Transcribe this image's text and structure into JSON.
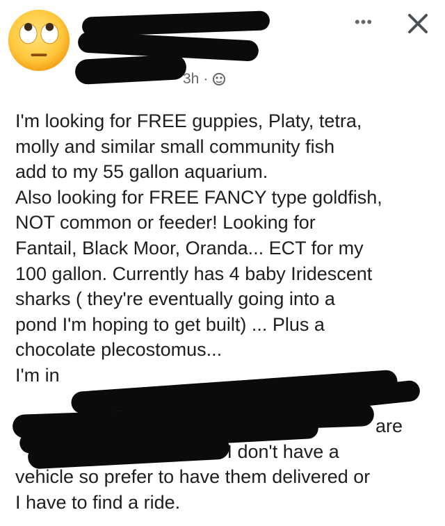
{
  "post": {
    "timestamp": "3h",
    "audience_icon": "globe-icon",
    "more_label": "•••",
    "close_icon": "close-icon",
    "body_lines": [
      "I'm  looking for FREE guppies, Platy, tetra,",
      "molly and similar small community fish",
      "add to my 55 gallon aquarium.",
      "Also looking for FREE FANCY type goldfish,",
      "NOT common or feeder! Looking for",
      "Fantail, Black Moor, Oranda... ECT for my",
      "100 gallon. Currently has 4 baby Iridescent",
      "sharks ( they're eventually going into a",
      "pond I'm hoping to get built) ... Plus a",
      "chocolate plecostomus...",
      "I'm in",
      "",
      "are",
      ".. I don't have a",
      "vehicle so prefer to have them delivered or",
      "I have to find a ride."
    ]
  }
}
